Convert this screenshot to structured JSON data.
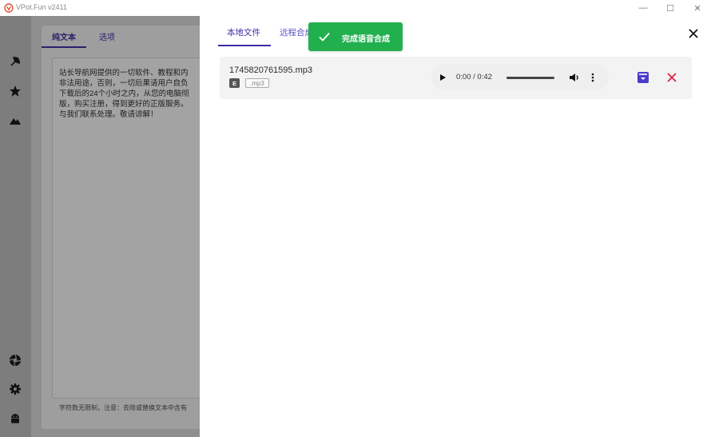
{
  "window": {
    "title": "VPot.Fun v2411",
    "minimize": "—",
    "maximize": "☐",
    "close": "✕"
  },
  "background": {
    "tabs": [
      "纯文本",
      "选项"
    ],
    "text_lines": "站长导航网提供的一切软件、教程和内\n非法用途，否则，一切后果请用户自负\n下载后的24个小时之内，从您的电脑彻\n版，购买注册，得到更好的正版服务。\n与我们联系处理。敬请谅解！",
    "hint": "字符数无限制，注意：去除或替换文本中含有"
  },
  "drawer": {
    "tabs": [
      "本地文件",
      "远程合成"
    ],
    "active_tab": 0,
    "toast": "完成语音合成",
    "files": [
      {
        "name": "1745820761595.mp3",
        "badge": "E",
        "ext": ".mp3",
        "time": "0:00 / 0:42",
        "progress": 0.0
      }
    ]
  },
  "icons": {
    "rail": [
      "satellite-icon",
      "star-icon",
      "mountain-icon",
      "aperture-icon",
      "settings-icon",
      "android-icon"
    ],
    "toast": "check-icon",
    "play": "play-icon",
    "volume": "volume-icon",
    "more": "more-vertical-icon",
    "save": "archive-icon",
    "remove": "close-icon"
  },
  "colors": {
    "accent": "#3b2ea8",
    "toast_bg": "#22b04f",
    "remove": "#d9264a",
    "save": "#4b3cc9"
  }
}
